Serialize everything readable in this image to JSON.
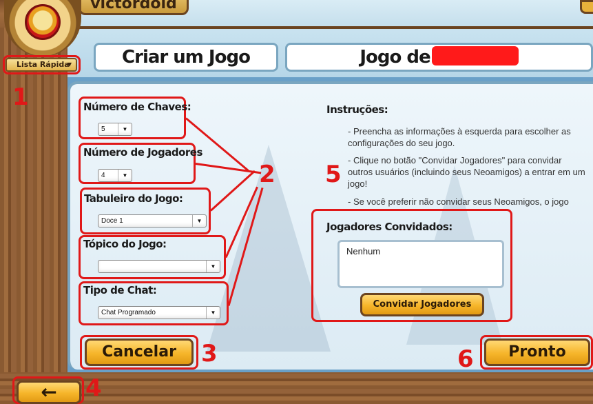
{
  "header": {
    "username": "victordold",
    "quick_list": "Lista Rápida",
    "create_title": "Criar um Jogo",
    "game_title": "Jogo de"
  },
  "form": {
    "keys": {
      "label": "Número de Chaves:",
      "value": "5"
    },
    "players": {
      "label": "Número de Jogadores",
      "value": "4"
    },
    "board": {
      "label": "Tabuleiro do Jogo:",
      "value": "Doce 1"
    },
    "topic": {
      "label": "Tópico do Jogo:",
      "value": ""
    },
    "chat": {
      "label": "Tipo de Chat:",
      "value": "Chat Programado"
    }
  },
  "instructions": {
    "title": "Instruções:",
    "line1": "- Preencha as informações à esquerda para escolher as configurações do seu jogo.",
    "line2": "- Clique no botão \"Convidar Jogadores\" para convidar outros usuários (incluindo seus Neoamigos) a entrar em um jogo!",
    "line3": "- Se você preferir não convidar seus Neoamigos, o jogo"
  },
  "invited": {
    "title": "Jogadores Convidados:",
    "list_value": "Nenhum",
    "invite_button": "Convidar Jogadores"
  },
  "buttons": {
    "cancel": "Cancelar",
    "ready": "Pronto",
    "back": "←"
  },
  "annotations": {
    "n1": "1",
    "n2": "2",
    "n3": "3",
    "n4": "4",
    "n5": "5",
    "n6": "6"
  },
  "colors": {
    "annotation_red": "#e01818",
    "button_gold": "#f6b52a",
    "panel_blue": "#dcebf4",
    "wood": "#8a5a32"
  }
}
